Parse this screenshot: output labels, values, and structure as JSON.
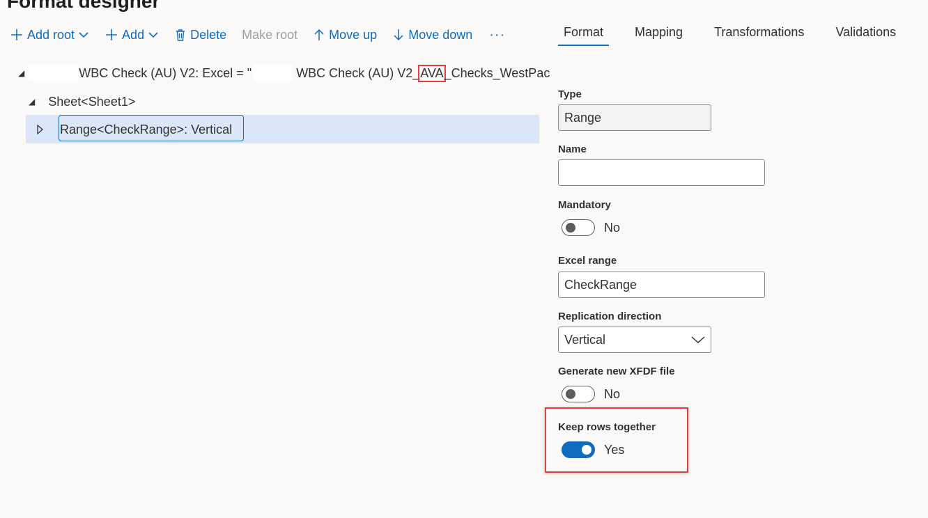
{
  "page": {
    "title": "Format designer"
  },
  "toolbar": {
    "add_root": "Add root",
    "add": "Add",
    "delete": "Delete",
    "make_root": "Make root",
    "move_up": "Move up",
    "move_down": "Move down",
    "more": "···"
  },
  "tabs": [
    "Format",
    "Mapping",
    "Transformations",
    "Validations"
  ],
  "tree": {
    "root": {
      "text_a": "WBC Check (AU) V2: Excel = \"",
      "text_b": "WBC Check (AU) V2_",
      "highlight": "AVA",
      "text_c": "_Checks_WestPac"
    },
    "sheet": "Sheet<Sheet1>",
    "range": "Range<CheckRange>: Vertical"
  },
  "properties": {
    "type": {
      "label": "Type",
      "value": "Range"
    },
    "name": {
      "label": "Name",
      "value": ""
    },
    "mandatory": {
      "label": "Mandatory",
      "state": "No"
    },
    "excel_range": {
      "label": "Excel range",
      "value": "CheckRange"
    },
    "replication_direction": {
      "label": "Replication direction",
      "value": "Vertical"
    },
    "generate_xfdf": {
      "label": "Generate new XFDF file",
      "state": "No"
    },
    "keep_rows_together": {
      "label": "Keep rows together",
      "state": "Yes"
    }
  },
  "colors": {
    "accent": "#0f6cbd",
    "highlight_frame": "#e04040",
    "selected_row": "#dbe6f8"
  }
}
